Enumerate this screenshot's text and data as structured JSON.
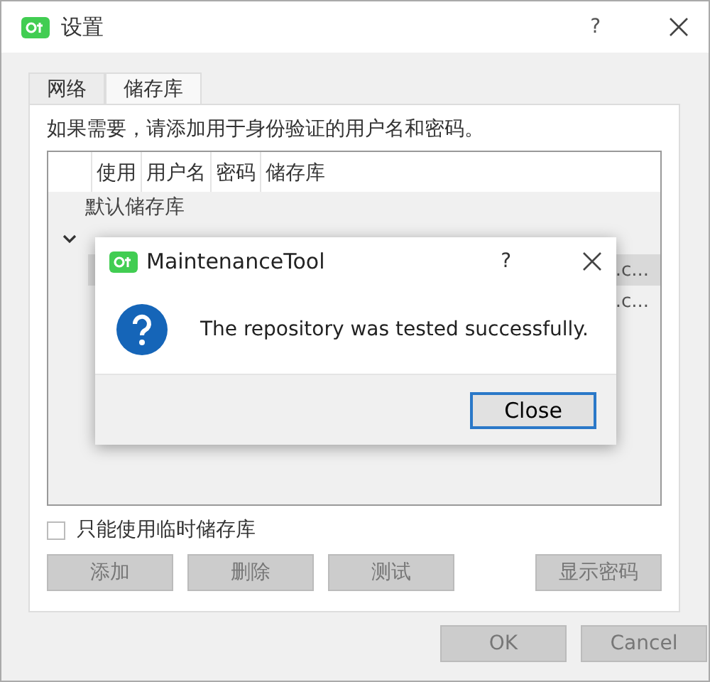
{
  "window": {
    "title": "设置",
    "help": "?"
  },
  "tabs": [
    {
      "label": "网络",
      "selected": false
    },
    {
      "label": "储存库",
      "selected": true
    }
  ],
  "instruction": "如果需要，请添加用于身份验证的用户名和密码。",
  "table": {
    "columns": [
      "使用",
      "用户名",
      "密码",
      "储存库"
    ],
    "rows": [
      {
        "label": "默认储存库",
        "children": []
      },
      {
        "expanded": true,
        "children": [
          {
            "repository": ".c...",
            "selected": true
          },
          {
            "repository": ".c...",
            "selected": false
          }
        ]
      }
    ]
  },
  "temp_only": {
    "label": "只能使用临时储存库",
    "checked": false
  },
  "actions": [
    {
      "label": "添加",
      "disabled": true
    },
    {
      "label": "删除",
      "disabled": true
    },
    {
      "label": "测试",
      "disabled": true
    },
    {
      "label": "显示密码",
      "disabled": true
    }
  ],
  "footer_buttons": [
    {
      "label": "OK",
      "disabled": true
    },
    {
      "label": "Cancel",
      "disabled": true
    }
  ],
  "dialog": {
    "title": "MaintenanceTool",
    "help": "?",
    "kind": "question",
    "message": "The repository was tested successfully.",
    "buttons": [
      {
        "label": "Close",
        "default": true
      }
    ]
  }
}
